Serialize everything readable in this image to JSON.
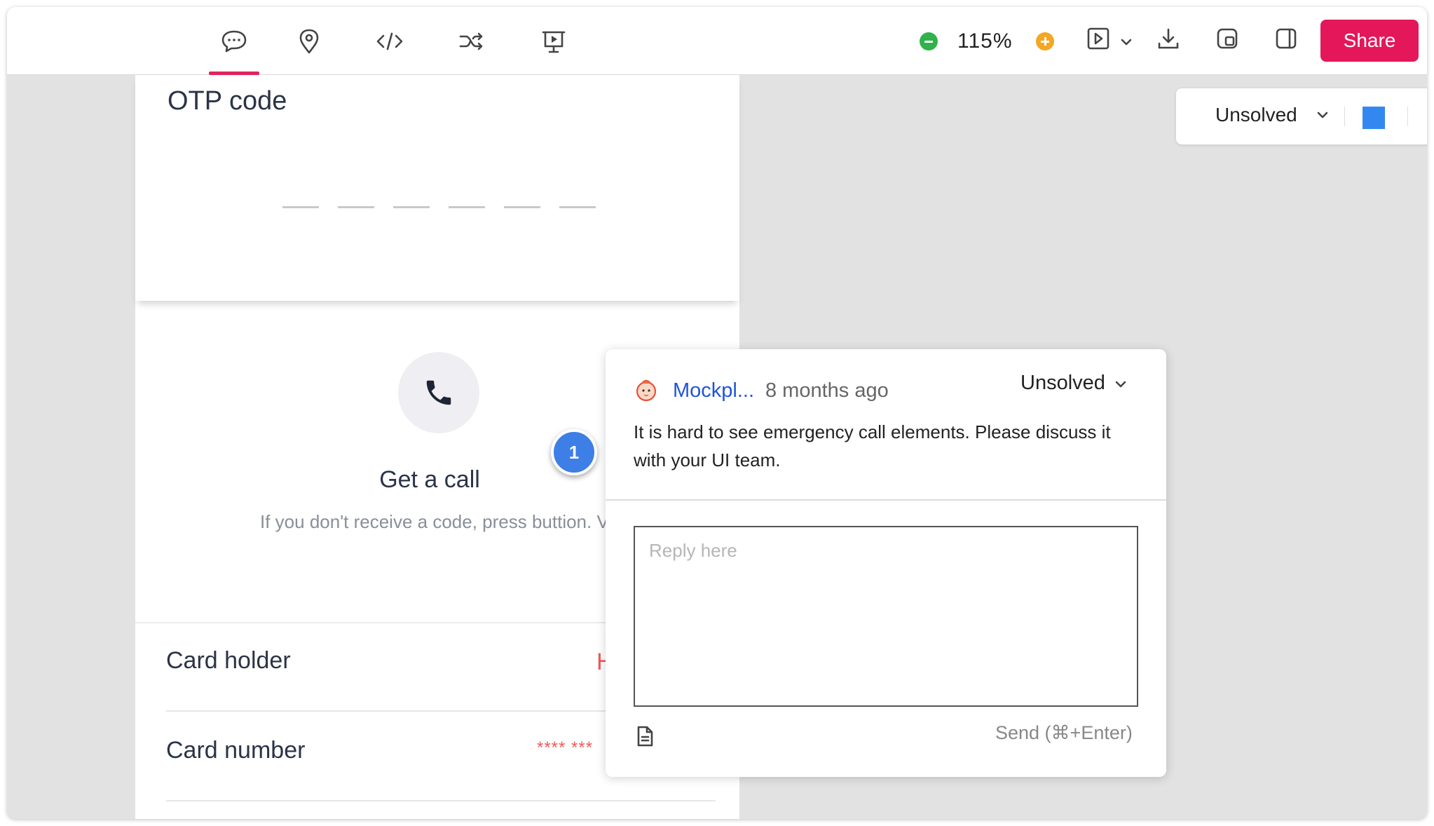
{
  "toolbar": {
    "tools": [
      "comment-tool",
      "pin-tool",
      "code-tool",
      "flow-tool",
      "present-tool"
    ],
    "active_tool": "comment-tool",
    "zoom": "115%",
    "share_label": "Share",
    "icons": [
      "play-icon",
      "chevron-down-icon",
      "download-icon",
      "multi-window-icon",
      "sidebar-icon"
    ]
  },
  "filter": {
    "label": "Unsolved",
    "color": "#3388f0"
  },
  "prototype": {
    "otp_title": "OTP code",
    "call_title": "Get a call",
    "call_desc": "If you don't receive a code, press buttion. V",
    "card_holder_label": "Card holder",
    "card_holder_value": "H",
    "card_number_label": "Card number",
    "card_number_value": "**** ***"
  },
  "comment": {
    "pin_number": "1",
    "author": "Mockpl...",
    "time": "8 months ago",
    "status": "Unsolved",
    "text": "It is hard to see emergency call elements. Please discuss it with your UI team.",
    "reply_placeholder": "Reply here",
    "send_hint": "Send (⌘+Enter)"
  },
  "colors": {
    "accent": "#e3175a",
    "pin": "#3d7fe6",
    "link": "#1f55d6",
    "zoom_out": "#2fb24a",
    "zoom_in": "#f3a722"
  }
}
